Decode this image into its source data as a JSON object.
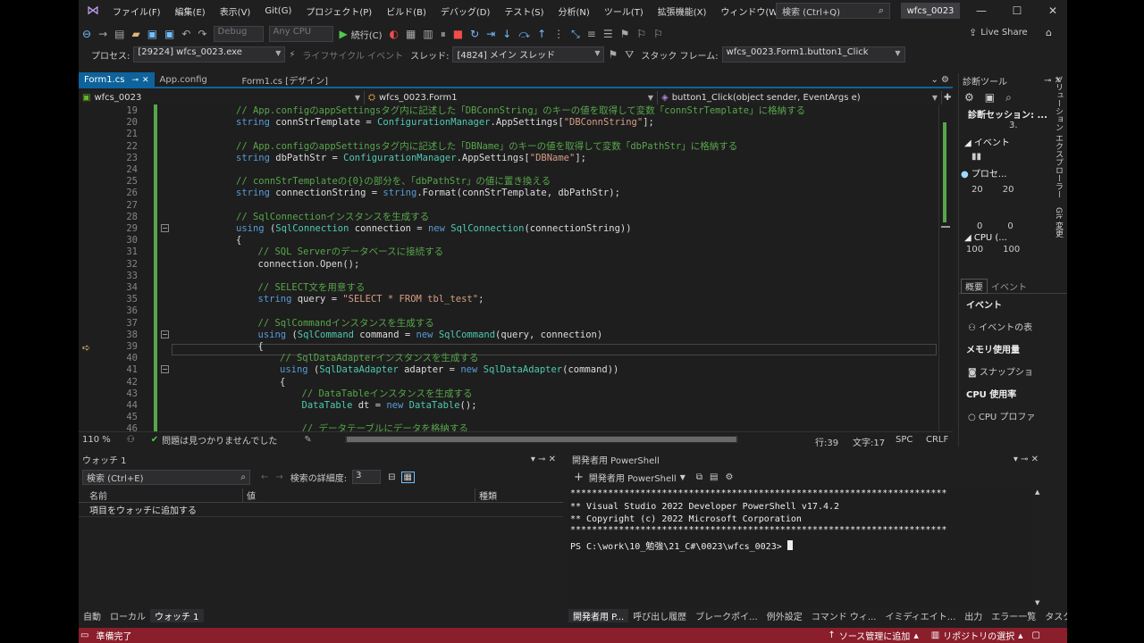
{
  "menu": {
    "items": [
      "ファイル(F)",
      "編集(E)",
      "表示(V)",
      "Git(G)",
      "プロジェクト(P)",
      "ビルド(B)",
      "デバッグ(D)",
      "テスト(S)",
      "分析(N)",
      "ツール(T)",
      "拡張機能(X)",
      "ウィンドウ(W)",
      "ヘルプ(H)"
    ],
    "search_placeholder": "検索 (Ctrl+Q)",
    "solution_name": "wfcs_0023"
  },
  "toolbar": {
    "config": "Debug",
    "platform": "Any CPU",
    "continue_label": "続行(C)",
    "live_share": "Live Share"
  },
  "debug_bar": {
    "process_label": "プロセス:",
    "process_value": "[29224] wfcs_0023.exe",
    "lifecycle_label": "ライフサイクル イベント",
    "thread_label": "スレッド:",
    "thread_value": "[4824] メイン スレッド",
    "stack_label": "スタック フレーム:",
    "stack_value": "wfcs_0023.Form1.button1_Click"
  },
  "tabs": [
    {
      "label": "Form1.cs"
    },
    {
      "label": "App.config"
    },
    {
      "label": "Form1.cs [デザイン]"
    }
  ],
  "nav": {
    "project": "wfcs_0023",
    "class": "wfcs_0023.Form1",
    "method": "button1_Click(object sender, EventArgs e)"
  },
  "code_lines": [
    {
      "n": "19",
      "indent": 3,
      "parts": [
        {
          "c": "com",
          "t": "// App.configのappSettingsタグ内に記述した「DBConnString」のキーの値を取得して変数「connStrTemplate」に格納する"
        }
      ]
    },
    {
      "n": "20",
      "indent": 3,
      "parts": [
        {
          "c": "kw",
          "t": "string "
        },
        {
          "c": "tx",
          "t": "connStrTemplate = "
        },
        {
          "c": "ty",
          "t": "ConfigurationManager"
        },
        {
          "c": "tx",
          "t": ".AppSettings["
        },
        {
          "c": "str",
          "t": "\"DBConnString\""
        },
        {
          "c": "tx",
          "t": "];"
        }
      ]
    },
    {
      "n": "21",
      "indent": 0,
      "parts": []
    },
    {
      "n": "22",
      "indent": 3,
      "parts": [
        {
          "c": "com",
          "t": "// App.configのappSettingsタグ内に記述した「DBName」のキーの値を取得して変数「dbPathStr」に格納する"
        }
      ]
    },
    {
      "n": "23",
      "indent": 3,
      "parts": [
        {
          "c": "kw",
          "t": "string "
        },
        {
          "c": "tx",
          "t": "dbPathStr = "
        },
        {
          "c": "ty",
          "t": "ConfigurationManager"
        },
        {
          "c": "tx",
          "t": ".AppSettings["
        },
        {
          "c": "str",
          "t": "\"DBName\""
        },
        {
          "c": "tx",
          "t": "];"
        }
      ]
    },
    {
      "n": "24",
      "indent": 0,
      "parts": []
    },
    {
      "n": "25",
      "indent": 3,
      "parts": [
        {
          "c": "com",
          "t": "// connStrTemplateの{0}の部分を、「dbPathStr」の値に置き換える"
        }
      ]
    },
    {
      "n": "26",
      "indent": 3,
      "parts": [
        {
          "c": "kw",
          "t": "string "
        },
        {
          "c": "tx",
          "t": "connectionString = "
        },
        {
          "c": "kw",
          "t": "string"
        },
        {
          "c": "tx",
          "t": ".Format(connStrTemplate, dbPathStr);"
        }
      ]
    },
    {
      "n": "27",
      "indent": 0,
      "parts": []
    },
    {
      "n": "28",
      "indent": 3,
      "parts": [
        {
          "c": "com",
          "t": "// SqlConnectionインスタンスを生成する"
        }
      ]
    },
    {
      "n": "29",
      "indent": 3,
      "parts": [
        {
          "c": "kw",
          "t": "using "
        },
        {
          "c": "tx",
          "t": "("
        },
        {
          "c": "ty",
          "t": "SqlConnection"
        },
        {
          "c": "tx",
          "t": " connection = "
        },
        {
          "c": "kw",
          "t": "new "
        },
        {
          "c": "ty",
          "t": "SqlConnection"
        },
        {
          "c": "tx",
          "t": "(connectionString))"
        }
      ]
    },
    {
      "n": "30",
      "indent": 3,
      "parts": [
        {
          "c": "tx",
          "t": "{"
        }
      ]
    },
    {
      "n": "31",
      "indent": 4,
      "parts": [
        {
          "c": "com",
          "t": "// SQL Serverのデータベースに接続する"
        }
      ]
    },
    {
      "n": "32",
      "indent": 4,
      "parts": [
        {
          "c": "tx",
          "t": "connection.Open();"
        }
      ]
    },
    {
      "n": "33",
      "indent": 0,
      "parts": []
    },
    {
      "n": "34",
      "indent": 4,
      "parts": [
        {
          "c": "com",
          "t": "// SELECT文を用意する"
        }
      ]
    },
    {
      "n": "35",
      "indent": 4,
      "parts": [
        {
          "c": "kw",
          "t": "string "
        },
        {
          "c": "tx",
          "t": "query = "
        },
        {
          "c": "str",
          "t": "\"SELECT * FROM tbl_test\""
        },
        {
          "c": "tx",
          "t": ";"
        }
      ]
    },
    {
      "n": "36",
      "indent": 0,
      "parts": []
    },
    {
      "n": "37",
      "indent": 4,
      "parts": [
        {
          "c": "com",
          "t": "// SqlCommandインスタンスを生成する"
        }
      ]
    },
    {
      "n": "38",
      "indent": 4,
      "parts": [
        {
          "c": "kw",
          "t": "using "
        },
        {
          "c": "tx",
          "t": "("
        },
        {
          "c": "ty",
          "t": "SqlCommand"
        },
        {
          "c": "tx",
          "t": " command = "
        },
        {
          "c": "kw",
          "t": "new "
        },
        {
          "c": "ty",
          "t": "SqlCommand"
        },
        {
          "c": "tx",
          "t": "(query, connection)"
        }
      ]
    },
    {
      "n": "39",
      "indent": 4,
      "parts": [
        {
          "c": "tx",
          "t": "{"
        }
      ]
    },
    {
      "n": "40",
      "indent": 5,
      "parts": [
        {
          "c": "com",
          "t": "// SqlDataAdapterインスタンスを生成する"
        }
      ]
    },
    {
      "n": "41",
      "indent": 5,
      "parts": [
        {
          "c": "kw",
          "t": "using "
        },
        {
          "c": "tx",
          "t": "("
        },
        {
          "c": "ty",
          "t": "SqlDataAdapter"
        },
        {
          "c": "tx",
          "t": " adapter = "
        },
        {
          "c": "kw",
          "t": "new "
        },
        {
          "c": "ty",
          "t": "SqlDataAdapter"
        },
        {
          "c": "tx",
          "t": "(command))"
        }
      ]
    },
    {
      "n": "42",
      "indent": 5,
      "parts": [
        {
          "c": "tx",
          "t": "{"
        }
      ]
    },
    {
      "n": "43",
      "indent": 6,
      "parts": [
        {
          "c": "com",
          "t": "// DataTableインスタンスを生成する"
        }
      ]
    },
    {
      "n": "44",
      "indent": 6,
      "parts": [
        {
          "c": "ty",
          "t": "DataTable"
        },
        {
          "c": "tx",
          "t": " dt = "
        },
        {
          "c": "kw",
          "t": "new "
        },
        {
          "c": "ty",
          "t": "DataTable"
        },
        {
          "c": "tx",
          "t": "();"
        }
      ]
    },
    {
      "n": "45",
      "indent": 0,
      "parts": []
    },
    {
      "n": "46",
      "indent": 6,
      "parts": [
        {
          "c": "com",
          "t": "// データテーブルにデータを格納する"
        }
      ]
    }
  ],
  "editor_status": {
    "zoom": "110 %",
    "issues": "問題は見つかりませんでした",
    "line": "行:39",
    "col": "文字:17",
    "spc": "SPC",
    "crlf": "CRLF"
  },
  "diag": {
    "title": "診断ツール",
    "session": "診断セッション: ...",
    "session_val": "3.",
    "events": "イベント",
    "process": "プロセ...",
    "p20a": "20",
    "p20b": "20",
    "p0a": "0",
    "p0b": "0",
    "cpu": "CPU (...",
    "c100a": "100",
    "c100b": "100",
    "tab_summary": "概要",
    "tab_events": "イベント",
    "sec_events": "イベント",
    "show_events": "イベントの表",
    "mem": "メモリ使用量",
    "snapshot": "スナップショ",
    "cpu_usage": "CPU 使用率",
    "cpu_profile": "CPU プロファ"
  },
  "side_strip": {
    "solution": "ソリューション エクスプローラー",
    "git": "Git 変更"
  },
  "watch": {
    "title": "ウォッチ 1",
    "search_placeholder": "検索 (Ctrl+E)",
    "depth_label": "検索の詳細度:",
    "depth_value": "3",
    "col_name": "名前",
    "col_value": "値",
    "col_type": "種類",
    "add_item": "項目をウォッチに追加する",
    "tabs": [
      "自動",
      "ローカル",
      "ウォッチ 1"
    ]
  },
  "powershell": {
    "title": "開発者用 PowerShell",
    "button": "開発者用 PowerShell",
    "stars": "**********************************************************************",
    "line1": "** Visual Studio 2022 Developer PowerShell v17.4.2",
    "line2": "** Copyright (c) 2022 Microsoft Corporation",
    "prompt": "PS C:\\work\\10_勉強\\21_C#\\0023\\wfcs_0023> ",
    "tabs": [
      "開発者用 P...",
      "呼び出し履歴",
      "ブレークポイ...",
      "例外設定",
      "コマンド ウィ...",
      "イミディエイト...",
      "出力",
      "エラー一覧",
      "タスク一覧"
    ]
  },
  "status": {
    "ready": "準備完了",
    "source_control": "ソース管理に追加",
    "repo": "リポジトリの選択"
  },
  "colors": {
    "accent": "#0e639c",
    "status_bar": "#8a1f2b",
    "breakpoint_arrow": "#e5c07b"
  }
}
